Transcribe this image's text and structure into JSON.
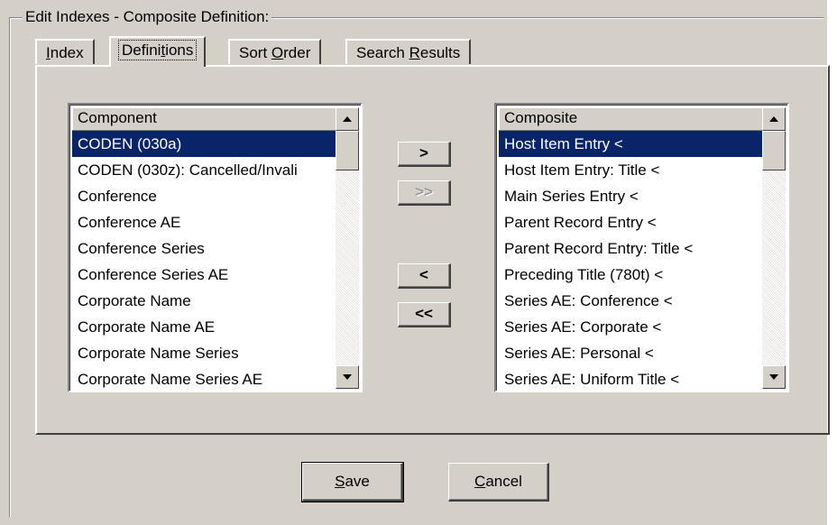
{
  "group": {
    "title": "Edit Indexes - Composite Definition:"
  },
  "tabs": [
    {
      "pre": "",
      "key": "I",
      "post": "ndex",
      "active": false
    },
    {
      "pre": "Defini",
      "key": "t",
      "post": "ions",
      "active": true
    },
    {
      "pre": "Sort ",
      "key": "O",
      "post": "rder",
      "active": false
    },
    {
      "pre": "Search ",
      "key": "R",
      "post": "esults",
      "active": false
    }
  ],
  "component_list": {
    "header": "Component",
    "items": [
      "CODEN (030a)",
      "CODEN (030z): Cancelled/Invali",
      "Conference",
      "Conference AE",
      "Conference Series",
      "Conference Series AE",
      "Corporate Name",
      "Corporate Name AE",
      "Corporate Name Series",
      "Corporate Name Series AE"
    ],
    "selected_index": 0
  },
  "composite_list": {
    "header": "Composite",
    "items": [
      "Host Item Entry <",
      "Host Item Entry: Title <",
      "Main Series Entry <",
      "Parent Record Entry <",
      "Parent Record Entry: Title <",
      "Preceding Title (780t) <",
      "Series AE: Conference <",
      "Series AE: Corporate <",
      "Series AE: Personal <",
      "Series AE: Uniform Title <"
    ],
    "selected_index": 0
  },
  "transfer": {
    "add": ">",
    "add_all": ">>",
    "remove": "<",
    "remove_all": "<<"
  },
  "buttons": {
    "save": {
      "pre": "",
      "key": "S",
      "post": "ave"
    },
    "cancel": {
      "pre": "",
      "key": "C",
      "post": "ancel"
    }
  },
  "colors": {
    "face": "#d4d0c8",
    "selection": "#0a246a",
    "selection_text": "#ffffff"
  }
}
